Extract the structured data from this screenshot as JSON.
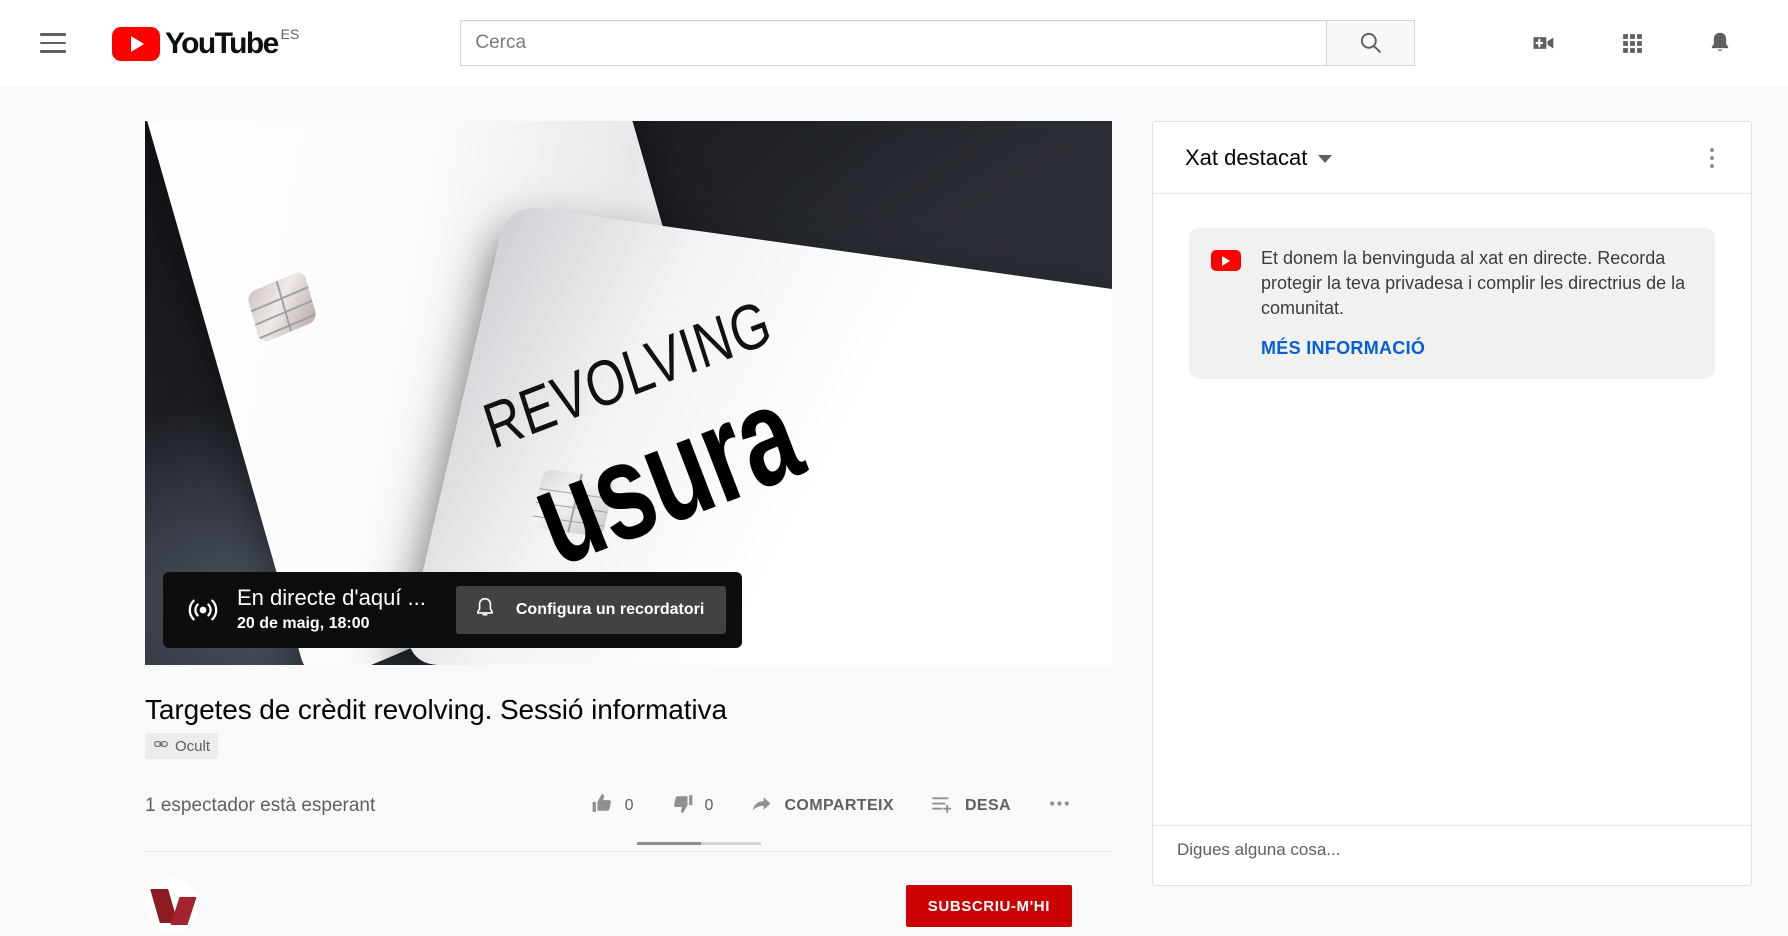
{
  "header": {
    "menu_icon": "hamburger-menu-icon",
    "logo_text": "YouTube",
    "logo_country": "ES",
    "search": {
      "placeholder": "Cerca",
      "value": "",
      "button_icon": "search-icon"
    },
    "icons": [
      {
        "name": "create-video-icon",
        "label": "Crea"
      },
      {
        "name": "apps-grid-icon",
        "label": "Aplicacions de YouTube"
      },
      {
        "name": "notifications-bell-icon",
        "label": "Notificacions"
      }
    ]
  },
  "video": {
    "thumbnail": {
      "line1": "REVOLVING",
      "line2": "usura"
    },
    "live_overlay": {
      "icon": "live-broadcast-icon",
      "countdown": "En directe d'aquí ...",
      "date": "20 de maig, 18:00",
      "reminder_icon": "bell-icon",
      "reminder_label": "Configura un recordatori"
    },
    "title": "Targetes de crèdit revolving. Sessió informativa",
    "visibility_badge": {
      "icon": "link-icon",
      "label": "Ocult"
    },
    "viewers": "1 espectador està esperant",
    "actions": {
      "like": {
        "icon": "thumb-up-icon",
        "count": "0"
      },
      "dislike": {
        "icon": "thumb-down-icon",
        "count": "0"
      },
      "share": {
        "icon": "share-arrow-icon",
        "label": "COMPARTEIX"
      },
      "save": {
        "icon": "save-to-playlist-icon",
        "label": "DESA"
      },
      "more": {
        "icon": "more-horizontal-icon",
        "label": ""
      }
    },
    "ratio_percent": 52,
    "subscribe_label": "SUBSCRIU-M'HI"
  },
  "chat": {
    "mode_label": "Xat destacat",
    "caret_icon": "chevron-down-icon",
    "kebab_icon": "more-vertical-icon",
    "welcome": {
      "logo_icon": "youtube-logo-icon",
      "message": "Et donem la benvinguda al xat en directe. Recorda protegir la teva privadesa i complir les directrius de la comunitat.",
      "link_label": "MÉS INFORMACIÓ"
    },
    "footer_text": "Digues alguna cosa..."
  },
  "colors": {
    "brand_red": "#ff0000",
    "link_blue": "#065fd4",
    "subscribe_red": "#cc0000",
    "text_primary": "#030303",
    "text_secondary": "#606060",
    "page_bg": "#f9f9f9"
  }
}
